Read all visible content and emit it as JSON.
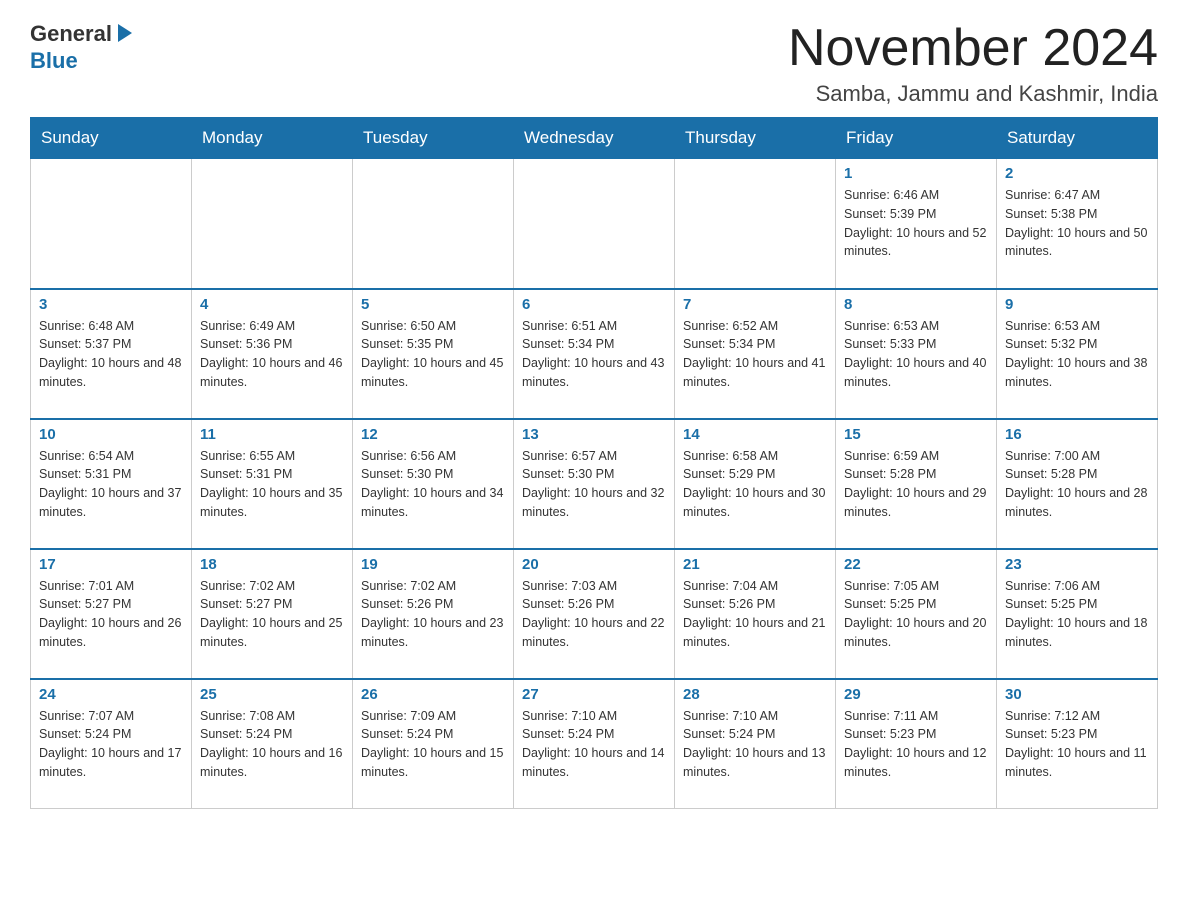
{
  "header": {
    "title": "November 2024",
    "subtitle": "Samba, Jammu and Kashmir, India",
    "logo_general": "General",
    "logo_blue": "Blue"
  },
  "days_of_week": [
    "Sunday",
    "Monday",
    "Tuesday",
    "Wednesday",
    "Thursday",
    "Friday",
    "Saturday"
  ],
  "weeks": [
    [
      {
        "day": "",
        "info": ""
      },
      {
        "day": "",
        "info": ""
      },
      {
        "day": "",
        "info": ""
      },
      {
        "day": "",
        "info": ""
      },
      {
        "day": "",
        "info": ""
      },
      {
        "day": "1",
        "info": "Sunrise: 6:46 AM\nSunset: 5:39 PM\nDaylight: 10 hours and 52 minutes."
      },
      {
        "day": "2",
        "info": "Sunrise: 6:47 AM\nSunset: 5:38 PM\nDaylight: 10 hours and 50 minutes."
      }
    ],
    [
      {
        "day": "3",
        "info": "Sunrise: 6:48 AM\nSunset: 5:37 PM\nDaylight: 10 hours and 48 minutes."
      },
      {
        "day": "4",
        "info": "Sunrise: 6:49 AM\nSunset: 5:36 PM\nDaylight: 10 hours and 46 minutes."
      },
      {
        "day": "5",
        "info": "Sunrise: 6:50 AM\nSunset: 5:35 PM\nDaylight: 10 hours and 45 minutes."
      },
      {
        "day": "6",
        "info": "Sunrise: 6:51 AM\nSunset: 5:34 PM\nDaylight: 10 hours and 43 minutes."
      },
      {
        "day": "7",
        "info": "Sunrise: 6:52 AM\nSunset: 5:34 PM\nDaylight: 10 hours and 41 minutes."
      },
      {
        "day": "8",
        "info": "Sunrise: 6:53 AM\nSunset: 5:33 PM\nDaylight: 10 hours and 40 minutes."
      },
      {
        "day": "9",
        "info": "Sunrise: 6:53 AM\nSunset: 5:32 PM\nDaylight: 10 hours and 38 minutes."
      }
    ],
    [
      {
        "day": "10",
        "info": "Sunrise: 6:54 AM\nSunset: 5:31 PM\nDaylight: 10 hours and 37 minutes."
      },
      {
        "day": "11",
        "info": "Sunrise: 6:55 AM\nSunset: 5:31 PM\nDaylight: 10 hours and 35 minutes."
      },
      {
        "day": "12",
        "info": "Sunrise: 6:56 AM\nSunset: 5:30 PM\nDaylight: 10 hours and 34 minutes."
      },
      {
        "day": "13",
        "info": "Sunrise: 6:57 AM\nSunset: 5:30 PM\nDaylight: 10 hours and 32 minutes."
      },
      {
        "day": "14",
        "info": "Sunrise: 6:58 AM\nSunset: 5:29 PM\nDaylight: 10 hours and 30 minutes."
      },
      {
        "day": "15",
        "info": "Sunrise: 6:59 AM\nSunset: 5:28 PM\nDaylight: 10 hours and 29 minutes."
      },
      {
        "day": "16",
        "info": "Sunrise: 7:00 AM\nSunset: 5:28 PM\nDaylight: 10 hours and 28 minutes."
      }
    ],
    [
      {
        "day": "17",
        "info": "Sunrise: 7:01 AM\nSunset: 5:27 PM\nDaylight: 10 hours and 26 minutes."
      },
      {
        "day": "18",
        "info": "Sunrise: 7:02 AM\nSunset: 5:27 PM\nDaylight: 10 hours and 25 minutes."
      },
      {
        "day": "19",
        "info": "Sunrise: 7:02 AM\nSunset: 5:26 PM\nDaylight: 10 hours and 23 minutes."
      },
      {
        "day": "20",
        "info": "Sunrise: 7:03 AM\nSunset: 5:26 PM\nDaylight: 10 hours and 22 minutes."
      },
      {
        "day": "21",
        "info": "Sunrise: 7:04 AM\nSunset: 5:26 PM\nDaylight: 10 hours and 21 minutes."
      },
      {
        "day": "22",
        "info": "Sunrise: 7:05 AM\nSunset: 5:25 PM\nDaylight: 10 hours and 20 minutes."
      },
      {
        "day": "23",
        "info": "Sunrise: 7:06 AM\nSunset: 5:25 PM\nDaylight: 10 hours and 18 minutes."
      }
    ],
    [
      {
        "day": "24",
        "info": "Sunrise: 7:07 AM\nSunset: 5:24 PM\nDaylight: 10 hours and 17 minutes."
      },
      {
        "day": "25",
        "info": "Sunrise: 7:08 AM\nSunset: 5:24 PM\nDaylight: 10 hours and 16 minutes."
      },
      {
        "day": "26",
        "info": "Sunrise: 7:09 AM\nSunset: 5:24 PM\nDaylight: 10 hours and 15 minutes."
      },
      {
        "day": "27",
        "info": "Sunrise: 7:10 AM\nSunset: 5:24 PM\nDaylight: 10 hours and 14 minutes."
      },
      {
        "day": "28",
        "info": "Sunrise: 7:10 AM\nSunset: 5:24 PM\nDaylight: 10 hours and 13 minutes."
      },
      {
        "day": "29",
        "info": "Sunrise: 7:11 AM\nSunset: 5:23 PM\nDaylight: 10 hours and 12 minutes."
      },
      {
        "day": "30",
        "info": "Sunrise: 7:12 AM\nSunset: 5:23 PM\nDaylight: 10 hours and 11 minutes."
      }
    ]
  ]
}
